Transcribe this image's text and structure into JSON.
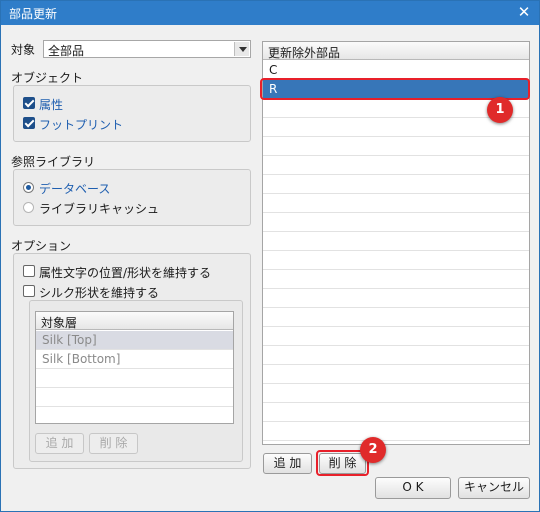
{
  "window": {
    "title": "部品更新",
    "close_glyph": "✕"
  },
  "target": {
    "label": "対象",
    "value": "全部品"
  },
  "object_group": {
    "heading": "オブジェクト",
    "items": [
      {
        "label": "属性",
        "checked": true
      },
      {
        "label": "フットプリント",
        "checked": true
      }
    ]
  },
  "ref_library": {
    "heading": "参照ライブラリ",
    "options": [
      {
        "label": "データベース",
        "selected": true
      },
      {
        "label": "ライブラリキャッシュ",
        "selected": false
      }
    ]
  },
  "options_group": {
    "heading": "オプション",
    "items": [
      {
        "label": "属性文字の位置/形状を維持する",
        "checked": false
      },
      {
        "label": "シルク形状を維持する",
        "checked": false
      }
    ],
    "layer_list": {
      "header": "対象層",
      "rows": [
        "Silk [Top]",
        "Silk [Bottom]"
      ]
    },
    "add_label": "追 加",
    "remove_label": "削 除"
  },
  "exclude_list": {
    "header": "更新除外部品",
    "rows": [
      "C",
      "R"
    ],
    "selected": "R"
  },
  "exclude_buttons": {
    "add_label": "追 加",
    "remove_label": "削 除"
  },
  "footer": {
    "ok_label": "O K",
    "cancel_label": "キャンセル"
  },
  "annotations": {
    "badge1": "1",
    "badge2": "2"
  },
  "colors": {
    "titlebar": "#2f7dc9",
    "selection": "#3776b8",
    "callout": "#e8202a"
  }
}
